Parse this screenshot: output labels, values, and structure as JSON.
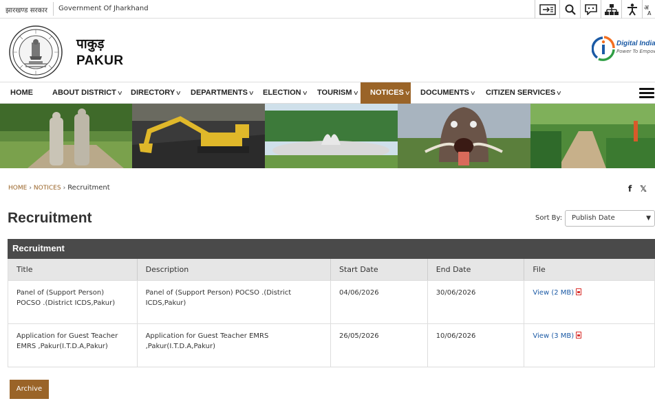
{
  "topbar": {
    "state_hindi": "झारखण्ड सरकार",
    "state_english": "Government Of Jharkhand",
    "icons": [
      "skip-to-content-icon",
      "search-icon",
      "social-share-icon",
      "sitemap-icon",
      "accessibility-icon",
      "language-icon"
    ]
  },
  "header": {
    "title_hindi": "पाकुड़",
    "title_english": "PAKUR",
    "digital_india_text": "Digital India",
    "digital_india_tagline": "Power To Empower"
  },
  "nav": {
    "items": [
      {
        "label": "HOME",
        "dropdown": false
      },
      {
        "label": "ABOUT DISTRICT",
        "dropdown": true
      },
      {
        "label": "DIRECTORY",
        "dropdown": true
      },
      {
        "label": "DEPARTMENTS",
        "dropdown": true
      },
      {
        "label": "ELECTION",
        "dropdown": true
      },
      {
        "label": "TOURISM",
        "dropdown": true
      },
      {
        "label": "NOTICES",
        "dropdown": true,
        "active": true
      },
      {
        "label": "DOCUMENTS",
        "dropdown": true
      },
      {
        "label": "CITIZEN SERVICES",
        "dropdown": true
      }
    ],
    "active_color": "#9a6428"
  },
  "breadcrumb": {
    "home": "HOME",
    "notices": "NOTICES",
    "current": "Recruitment"
  },
  "social": {
    "facebook": "f",
    "x": "𝕏"
  },
  "page": {
    "title": "Recruitment",
    "sort_label": "Sort By:",
    "sort_value": "Publish Date"
  },
  "table": {
    "caption": "Recruitment",
    "columns": [
      "Title",
      "Description",
      "Start Date",
      "End Date",
      "File"
    ],
    "rows": [
      {
        "title": "Panel of (Support Person) POCSO .(District ICDS,Pakur)",
        "description": "Panel of (Support Person) POCSO .(District ICDS,Pakur)",
        "start": "04/06/2026",
        "end": "30/06/2026",
        "file": "View (2 MB)"
      },
      {
        "title": "Application for Guest Teacher EMRS ,Pakur(I.T.D.A,Pakur)",
        "description": "Application for Guest Teacher EMRS ,Pakur(I.T.D.A,Pakur)",
        "start": "26/05/2026",
        "end": "10/06/2026",
        "file": "View (3 MB)"
      }
    ]
  },
  "archive_label": "Archive"
}
